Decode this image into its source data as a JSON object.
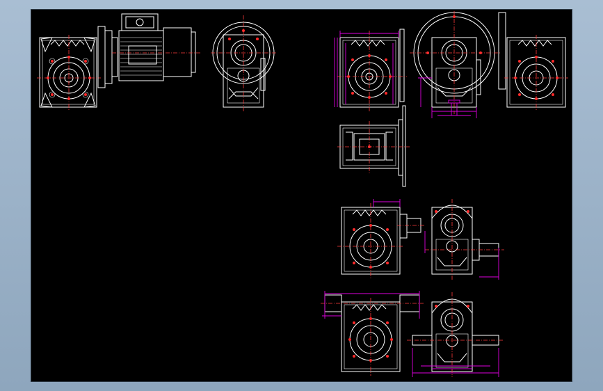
{
  "drawing": {
    "background": "#000000",
    "app_background": "#9fb4c9",
    "line_color": "#ffffff",
    "centerline_color": "#ff3a3a",
    "dimension_color": "#e000e0"
  },
  "views": [
    {
      "name": "gearbox-front-with-motor"
    },
    {
      "name": "motor-side"
    },
    {
      "name": "gearbox-end-view"
    },
    {
      "name": "dimensioned-front-view"
    },
    {
      "name": "dimensioned-side-view"
    },
    {
      "name": "flange-front-view"
    },
    {
      "name": "gearbox-top-view"
    },
    {
      "name": "input-shaft-front-view"
    },
    {
      "name": "input-shaft-side-view"
    },
    {
      "name": "double-shaft-front-view"
    },
    {
      "name": "double-shaft-side-view"
    }
  ]
}
